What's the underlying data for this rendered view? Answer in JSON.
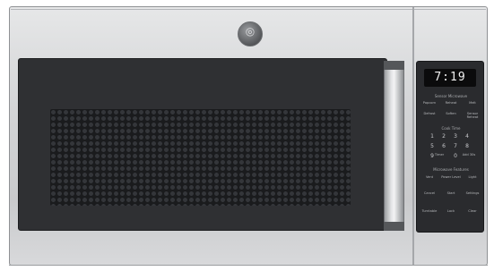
{
  "display": {
    "time": "7:19"
  },
  "panel": {
    "section1_title": "Sensor Microwave",
    "row1": [
      "Popcorn",
      "Reheat",
      "Melt"
    ],
    "row2": [
      "Defrost",
      "Soften",
      "Sensor Reheat"
    ],
    "cooktime_title": "Cook Time",
    "keypad": [
      "1",
      "2",
      "3",
      "4",
      "5",
      "6",
      "7",
      "8",
      "9",
      "Timer",
      "0",
      "Add 30s"
    ],
    "section3_title": "Microwave Features",
    "row3": [
      "Vent",
      "Power Level",
      "Light"
    ],
    "row4": [
      "Cancel",
      "Start",
      "Settings"
    ],
    "row5": [
      "Turntable",
      "Lock",
      "Clear"
    ]
  },
  "colors": {
    "stainless": "#d3d4d6",
    "door": "#2f3033",
    "panel": "#2a2b2e"
  },
  "icons": {
    "brand_logo": "monogram-icon"
  }
}
